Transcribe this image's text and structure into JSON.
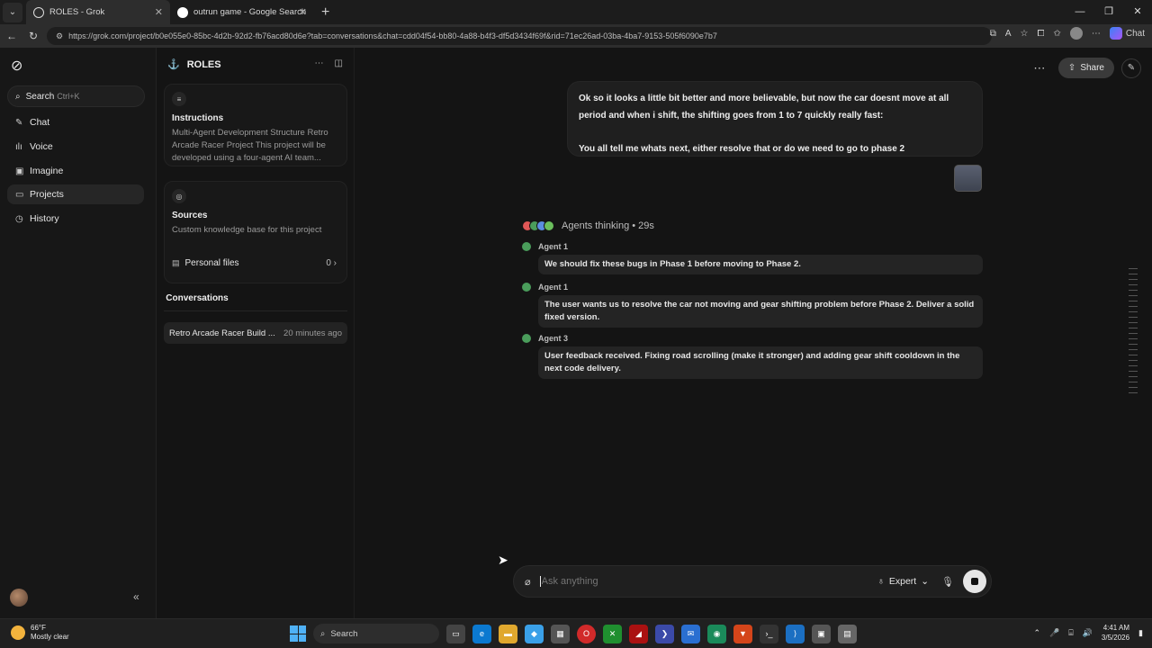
{
  "browser": {
    "tabs": [
      {
        "title": "ROLES - Grok",
        "active": true
      },
      {
        "title": "outrun game - Google Search",
        "active": false
      }
    ],
    "url": "https://grok.com/project/b0e055e0-85bc-4d2b-92d2-fb76acd80d6e?tab=conversations&chat=cdd04f54-bb80-4a88-b4f3-df5d3434f69f&rid=71ec26ad-03ba-4ba7-9153-505f6090e7b7",
    "chat_chip": "Chat"
  },
  "sidebar": {
    "search_label": "Search",
    "search_hint": "Ctrl+K",
    "items": [
      {
        "label": "Chat",
        "icon": "pencil-icon"
      },
      {
        "label": "Voice",
        "icon": "waveform-icon"
      },
      {
        "label": "Imagine",
        "icon": "image-icon"
      },
      {
        "label": "Projects",
        "icon": "folder-icon",
        "selected": true
      },
      {
        "label": "History",
        "icon": "history-icon"
      }
    ]
  },
  "project": {
    "name": "ROLES",
    "instructions": {
      "title": "Instructions",
      "body": "Multi-Agent Development Structure Retro Arcade Racer Project This project will be developed using a four-agent AI team..."
    },
    "sources": {
      "title": "Sources",
      "body": "Custom knowledge base for this project"
    },
    "personal_files": {
      "label": "Personal files",
      "count": "0"
    },
    "conversations_tab": "Conversations",
    "conversations": [
      {
        "name": "Retro Arcade Racer Build ...",
        "time": "20 minutes ago"
      }
    ]
  },
  "chat": {
    "share_label": "Share",
    "user_message": {
      "line1": "Ok so it looks a little bit better and more believable, but now the car doesnt move at all period and when i shift, the shifting goes from 1 to 7 quickly really fast:",
      "line2": "You all tell me whats next, either resolve that or do we need to go to phase 2"
    },
    "agents_status": "Agents thinking • 29s",
    "agent_messages": [
      {
        "agent": "Agent 1",
        "text": "We should fix these bugs in Phase 1 before moving to Phase 2."
      },
      {
        "agent": "Agent 1",
        "text": "The user wants us to resolve the car not moving and gear shifting problem before Phase 2. Deliver a solid fixed version."
      },
      {
        "agent": "Agent 3",
        "text": "User feedback received. Fixing road scrolling (make it stronger) and adding gear shift cooldown in the next code delivery."
      }
    ],
    "composer": {
      "placeholder": "Ask anything",
      "mode": "Expert"
    }
  },
  "taskbar": {
    "weather_temp": "66°F",
    "weather_desc": "Mostly clear",
    "search_label": "Search",
    "time": "4:41 AM",
    "date": "3/5/2026"
  }
}
